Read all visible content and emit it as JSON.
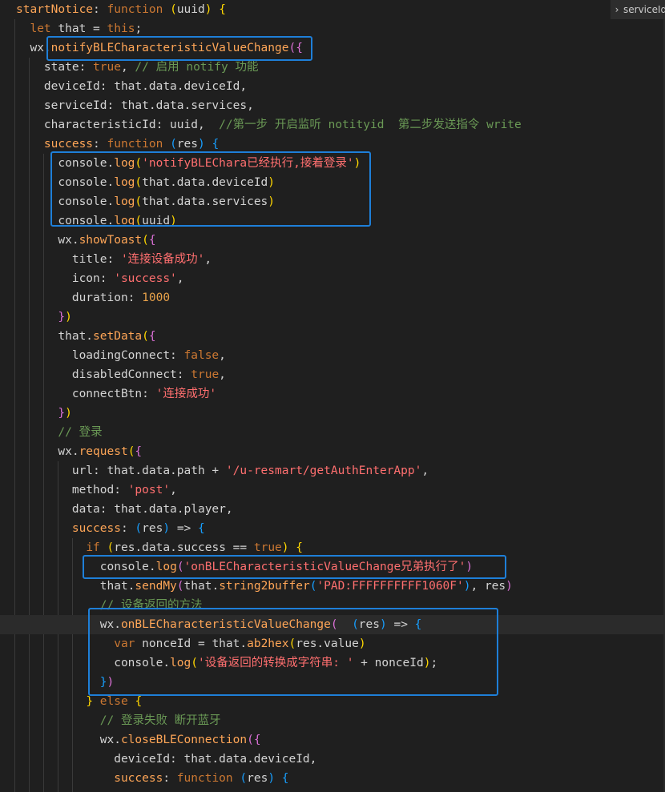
{
  "editor": {
    "tab_label": "serviceId",
    "colors": {
      "background": "#1f1f1f",
      "annotation_box": "#1e7fd8"
    },
    "lines": [
      [
        [
          "t-fnname",
          "startNotice"
        ],
        [
          "t-op",
          ": "
        ],
        [
          "t-kw",
          "function"
        ],
        [
          "t-op",
          " "
        ],
        [
          "t-br1",
          "("
        ],
        [
          "t-prop",
          "uuid"
        ],
        [
          "t-br1",
          ")"
        ],
        [
          "t-op",
          " "
        ],
        [
          "t-br1",
          "{"
        ]
      ],
      [
        [
          "t-op",
          "  "
        ],
        [
          "t-kw",
          "let"
        ],
        [
          "t-op",
          " that = "
        ],
        [
          "t-kw",
          "this"
        ],
        [
          "t-op",
          ";"
        ]
      ],
      [
        [
          "t-op",
          "  wx."
        ],
        [
          "t-fnname",
          "notifyBLECharacteristicValueChange"
        ],
        [
          "t-br2",
          "({"
        ]
      ],
      [
        [
          "t-op",
          "    state: "
        ],
        [
          "t-kw",
          "true"
        ],
        [
          "t-op",
          ", "
        ],
        [
          "t-cm",
          "// 启用 notify 功能"
        ]
      ],
      [
        [
          "t-op",
          "    deviceId: that.data.deviceId,"
        ]
      ],
      [
        [
          "t-op",
          "    serviceId: that.data.services,"
        ]
      ],
      [
        [
          "t-op",
          "    characteristicId: uuid,  "
        ],
        [
          "t-cm",
          "//第一步 开启监听 notityid  第二步发送指令 write"
        ]
      ],
      [
        [
          "t-op",
          "    "
        ],
        [
          "t-fnname",
          "success"
        ],
        [
          "t-op",
          ": "
        ],
        [
          "t-kw",
          "function"
        ],
        [
          "t-op",
          " "
        ],
        [
          "t-br3",
          "("
        ],
        [
          "t-prop",
          "res"
        ],
        [
          "t-br3",
          ")"
        ],
        [
          "t-op",
          " "
        ],
        [
          "t-br3",
          "{"
        ]
      ],
      [
        [
          "t-op",
          "      console."
        ],
        [
          "t-fnname",
          "log"
        ],
        [
          "t-br1",
          "("
        ],
        [
          "t-str",
          "'notifyBLEChara已经执行,接着登录'"
        ],
        [
          "t-br1",
          ")"
        ]
      ],
      [
        [
          "t-op",
          "      console."
        ],
        [
          "t-fnname",
          "log"
        ],
        [
          "t-br1",
          "("
        ],
        [
          "t-op",
          "that.data.deviceId"
        ],
        [
          "t-br1",
          ")"
        ]
      ],
      [
        [
          "t-op",
          "      console."
        ],
        [
          "t-fnname",
          "log"
        ],
        [
          "t-br1",
          "("
        ],
        [
          "t-op",
          "that.data.services"
        ],
        [
          "t-br1",
          ")"
        ]
      ],
      [
        [
          "t-op",
          "      console."
        ],
        [
          "t-fnname",
          "log"
        ],
        [
          "t-br1",
          "("
        ],
        [
          "t-op",
          "uuid"
        ],
        [
          "t-br1",
          ")"
        ]
      ],
      [
        [
          "t-op",
          "      wx."
        ],
        [
          "t-fnname",
          "showToast"
        ],
        [
          "t-br1",
          "("
        ],
        [
          "t-br2",
          "{"
        ]
      ],
      [
        [
          "t-op",
          "        title: "
        ],
        [
          "t-str",
          "'连接设备成功'"
        ],
        [
          "t-op",
          ","
        ]
      ],
      [
        [
          "t-op",
          "        icon: "
        ],
        [
          "t-str",
          "'success'"
        ],
        [
          "t-op",
          ","
        ]
      ],
      [
        [
          "t-op",
          "        duration: "
        ],
        [
          "t-num",
          "1000"
        ]
      ],
      [
        [
          "t-op",
          "      "
        ],
        [
          "t-br2",
          "}"
        ],
        [
          "t-br1",
          ")"
        ]
      ],
      [
        [
          "t-op",
          "      that."
        ],
        [
          "t-fnname",
          "setData"
        ],
        [
          "t-br1",
          "("
        ],
        [
          "t-br2",
          "{"
        ]
      ],
      [
        [
          "t-op",
          "        loadingConnect: "
        ],
        [
          "t-kw",
          "false"
        ],
        [
          "t-op",
          ","
        ]
      ],
      [
        [
          "t-op",
          "        disabledConnect: "
        ],
        [
          "t-kw",
          "true"
        ],
        [
          "t-op",
          ","
        ]
      ],
      [
        [
          "t-op",
          "        connectBtn: "
        ],
        [
          "t-str",
          "'连接成功'"
        ]
      ],
      [
        [
          "t-op",
          "      "
        ],
        [
          "t-br2",
          "}"
        ],
        [
          "t-br1",
          ")"
        ]
      ],
      [
        [
          "t-op",
          "      "
        ],
        [
          "t-cm",
          "// 登录"
        ]
      ],
      [
        [
          "t-op",
          "      wx."
        ],
        [
          "t-fnname",
          "request"
        ],
        [
          "t-br1",
          "("
        ],
        [
          "t-br2",
          "{"
        ]
      ],
      [
        [
          "t-op",
          "        url: that.data.path + "
        ],
        [
          "t-str",
          "'/u-resmart/getAuthEnterApp'"
        ],
        [
          "t-op",
          ","
        ]
      ],
      [
        [
          "t-op",
          "        method: "
        ],
        [
          "t-str",
          "'post'"
        ],
        [
          "t-op",
          ","
        ]
      ],
      [
        [
          "t-op",
          "        data: that.data.player,"
        ]
      ],
      [
        [
          "t-op",
          "        "
        ],
        [
          "t-fnname",
          "success"
        ],
        [
          "t-op",
          ": "
        ],
        [
          "t-br3",
          "("
        ],
        [
          "t-prop",
          "res"
        ],
        [
          "t-br3",
          ")"
        ],
        [
          "t-op",
          " => "
        ],
        [
          "t-br3",
          "{"
        ]
      ],
      [
        [
          "t-op",
          "          "
        ],
        [
          "t-kw",
          "if"
        ],
        [
          "t-op",
          " "
        ],
        [
          "t-br1",
          "("
        ],
        [
          "t-op",
          "res.data.success == "
        ],
        [
          "t-kw",
          "true"
        ],
        [
          "t-br1",
          ")"
        ],
        [
          "t-op",
          " "
        ],
        [
          "t-br1",
          "{"
        ]
      ],
      [
        [
          "t-op",
          "            console."
        ],
        [
          "t-fnname",
          "log"
        ],
        [
          "t-br2",
          "("
        ],
        [
          "t-str",
          "'onBLECharacteristicValueChange兄弟执行了'"
        ],
        [
          "t-br2",
          ")"
        ]
      ],
      [
        [
          "t-op",
          "            that."
        ],
        [
          "t-fnname",
          "sendMy"
        ],
        [
          "t-br2",
          "("
        ],
        [
          "t-op",
          "that."
        ],
        [
          "t-fnname",
          "string2buffer"
        ],
        [
          "t-br3",
          "("
        ],
        [
          "t-str",
          "'PAD:FFFFFFFFFF1060F'"
        ],
        [
          "t-br3",
          ")"
        ],
        [
          "t-op",
          ", res"
        ],
        [
          "t-br2",
          ")"
        ]
      ],
      [
        [
          "t-op",
          "            "
        ],
        [
          "t-cm",
          "// 设备返回的方法"
        ]
      ],
      [
        [
          "t-op",
          "            wx."
        ],
        [
          "t-fnname",
          "onBLECharacteristicValueChange"
        ],
        [
          "t-br2",
          "("
        ],
        [
          "t-op",
          "  "
        ],
        [
          "t-br3",
          "("
        ],
        [
          "t-prop",
          "res"
        ],
        [
          "t-br3",
          ")"
        ],
        [
          "t-op",
          " => "
        ],
        [
          "t-br3",
          "{"
        ]
      ],
      [
        [
          "t-op",
          "              "
        ],
        [
          "t-kw",
          "var"
        ],
        [
          "t-op",
          " nonceId = that."
        ],
        [
          "t-fnname",
          "ab2hex"
        ],
        [
          "t-br1",
          "("
        ],
        [
          "t-op",
          "res.value"
        ],
        [
          "t-br1",
          ")"
        ]
      ],
      [
        [
          "t-op",
          "              console."
        ],
        [
          "t-fnname",
          "log"
        ],
        [
          "t-br1",
          "("
        ],
        [
          "t-str",
          "'设备返回的转换成字符串: '"
        ],
        [
          "t-op",
          " + nonceId"
        ],
        [
          "t-br1",
          ")"
        ],
        [
          "t-op",
          ";"
        ]
      ],
      [
        [
          "t-op",
          "            "
        ],
        [
          "t-br3",
          "}"
        ],
        [
          "t-br2",
          ")"
        ]
      ],
      [
        [
          "t-op",
          "          "
        ],
        [
          "t-br1",
          "}"
        ],
        [
          "t-op",
          " "
        ],
        [
          "t-kw",
          "else"
        ],
        [
          "t-op",
          " "
        ],
        [
          "t-br1",
          "{"
        ]
      ],
      [
        [
          "t-op",
          "            "
        ],
        [
          "t-cm",
          "// 登录失败 断开蓝牙"
        ]
      ],
      [
        [
          "t-op",
          "            wx."
        ],
        [
          "t-fnname",
          "closeBLEConnection"
        ],
        [
          "t-br2",
          "({"
        ]
      ],
      [
        [
          "t-op",
          "              deviceId: that.data.deviceId,"
        ]
      ],
      [
        [
          "t-op",
          "              "
        ],
        [
          "t-fnname",
          "success"
        ],
        [
          "t-op",
          ": "
        ],
        [
          "t-kw",
          "function"
        ],
        [
          "t-op",
          " "
        ],
        [
          "t-br3",
          "("
        ],
        [
          "t-prop",
          "res"
        ],
        [
          "t-br3",
          ")"
        ],
        [
          "t-op",
          " "
        ],
        [
          "t-br3",
          "{"
        ]
      ]
    ]
  }
}
